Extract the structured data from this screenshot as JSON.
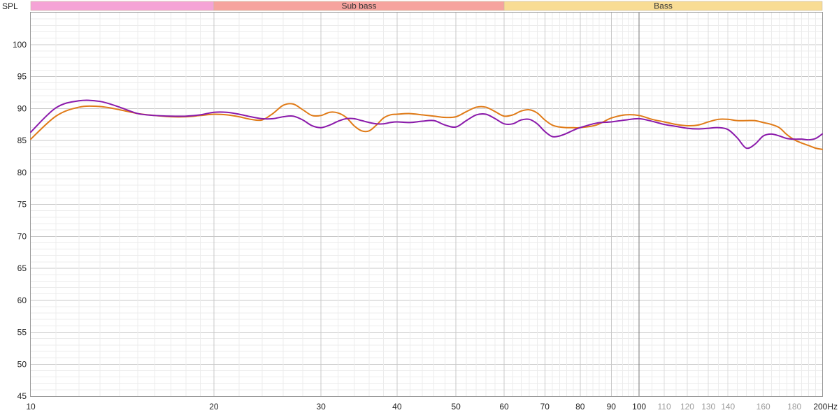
{
  "chart_data": {
    "type": "line",
    "ylabel": "SPL",
    "xunit": "Hz",
    "xscale": "log",
    "xlim": [
      10,
      200
    ],
    "ylim": [
      45,
      105
    ],
    "grid": true,
    "bands": [
      {
        "label": "",
        "from": 10,
        "to": 20,
        "color": "#f5a3d6"
      },
      {
        "label": "Sub bass",
        "from": 20,
        "to": 60,
        "color": "#f6a39e"
      },
      {
        "label": "Bass",
        "from": 60,
        "to": 200,
        "color": "#f8dc94"
      }
    ],
    "y_ticks": [
      {
        "value": 100,
        "label": "100"
      },
      {
        "value": 95,
        "label": "95"
      },
      {
        "value": 90,
        "label": "90"
      },
      {
        "value": 85,
        "label": "85"
      },
      {
        "value": 80,
        "label": "80"
      },
      {
        "value": 75,
        "label": "75"
      },
      {
        "value": 70,
        "label": "70"
      },
      {
        "value": 65,
        "label": "65"
      },
      {
        "value": 60,
        "label": "60"
      },
      {
        "value": 55,
        "label": "55"
      },
      {
        "value": 50,
        "label": "50"
      },
      {
        "value": 45,
        "label": "45"
      }
    ],
    "x_ticks": [
      {
        "value": 10,
        "label": "10",
        "major": true
      },
      {
        "value": 20,
        "label": "20",
        "major": true
      },
      {
        "value": 30,
        "label": "30",
        "major": true
      },
      {
        "value": 40,
        "label": "40",
        "major": true
      },
      {
        "value": 50,
        "label": "50",
        "major": true
      },
      {
        "value": 60,
        "label": "60",
        "major": true
      },
      {
        "value": 70,
        "label": "70",
        "major": true
      },
      {
        "value": 80,
        "label": "80",
        "major": true
      },
      {
        "value": 90,
        "label": "90",
        "major": true
      },
      {
        "value": 100,
        "label": "100",
        "major": true
      },
      {
        "value": 110,
        "label": "110",
        "major": false
      },
      {
        "value": 120,
        "label": "120",
        "major": false
      },
      {
        "value": 130,
        "label": "130",
        "major": false
      },
      {
        "value": 140,
        "label": "140",
        "major": false
      },
      {
        "value": 160,
        "label": "160",
        "major": false
      },
      {
        "value": 180,
        "label": "180",
        "major": false
      },
      {
        "value": 200,
        "label": "200Hz",
        "major": true
      }
    ],
    "series": [
      {
        "color": "#e07b18",
        "x": [
          10,
          11,
          12,
          13,
          14,
          15,
          16,
          17,
          18,
          19,
          20,
          21,
          22,
          23,
          24,
          25,
          26,
          27,
          28,
          29,
          30,
          31,
          32,
          33,
          34,
          35,
          36,
          37,
          38,
          39,
          40,
          42,
          44,
          46,
          48,
          50,
          52,
          54,
          56,
          58,
          60,
          62,
          64,
          66,
          68,
          70,
          72,
          74,
          76,
          78,
          80,
          85,
          90,
          95,
          100,
          105,
          110,
          115,
          120,
          125,
          130,
          135,
          140,
          145,
          150,
          155,
          160,
          165,
          170,
          175,
          180,
          185,
          190,
          195,
          200
        ],
        "y": [
          85.2,
          88.8,
          90.2,
          90.3,
          89.8,
          89.2,
          88.9,
          88.7,
          88.7,
          88.9,
          89.1,
          89.0,
          88.7,
          88.3,
          88.2,
          89.2,
          90.5,
          90.7,
          89.8,
          88.9,
          88.9,
          89.4,
          89.3,
          88.6,
          87.3,
          86.5,
          86.5,
          87.4,
          88.5,
          89.0,
          89.1,
          89.2,
          89.0,
          88.8,
          88.6,
          88.7,
          89.5,
          90.2,
          90.2,
          89.5,
          88.8,
          89.0,
          89.6,
          89.8,
          89.3,
          88.2,
          87.4,
          87.1,
          87.0,
          87.0,
          87.0,
          87.4,
          88.5,
          89.0,
          88.9,
          88.3,
          87.9,
          87.5,
          87.3,
          87.4,
          87.9,
          88.3,
          88.3,
          88.1,
          88.1,
          88.1,
          87.8,
          87.5,
          87.0,
          85.9,
          85.1,
          84.6,
          84.2,
          83.8,
          83.6
        ]
      },
      {
        "color": "#8b1aab",
        "x": [
          10,
          11,
          12,
          13,
          14,
          15,
          16,
          17,
          18,
          19,
          20,
          21,
          22,
          23,
          24,
          25,
          26,
          27,
          28,
          29,
          30,
          31,
          32,
          33,
          34,
          35,
          36,
          37,
          38,
          39,
          40,
          42,
          44,
          46,
          48,
          50,
          52,
          54,
          56,
          58,
          60,
          62,
          64,
          66,
          68,
          70,
          72,
          74,
          76,
          78,
          80,
          85,
          90,
          95,
          100,
          105,
          110,
          115,
          120,
          125,
          130,
          135,
          140,
          145,
          150,
          155,
          160,
          165,
          170,
          175,
          180,
          185,
          190,
          195,
          200
        ],
        "y": [
          86.3,
          90.1,
          91.2,
          91.1,
          90.2,
          89.2,
          88.9,
          88.8,
          88.8,
          89.0,
          89.4,
          89.4,
          89.1,
          88.7,
          88.4,
          88.4,
          88.7,
          88.8,
          88.2,
          87.3,
          87.0,
          87.4,
          88.0,
          88.4,
          88.4,
          88.1,
          87.8,
          87.6,
          87.6,
          87.8,
          87.9,
          87.8,
          88.0,
          88.1,
          87.4,
          87.1,
          88.1,
          89.0,
          89.1,
          88.4,
          87.6,
          87.6,
          88.2,
          88.3,
          87.6,
          86.4,
          85.6,
          85.7,
          86.1,
          86.6,
          87.0,
          87.7,
          87.9,
          88.2,
          88.4,
          88.0,
          87.5,
          87.2,
          86.9,
          86.8,
          86.9,
          87.0,
          86.7,
          85.4,
          83.8,
          84.4,
          85.7,
          86.0,
          85.7,
          85.3,
          85.2,
          85.2,
          85.1,
          85.3,
          86.0
        ]
      }
    ]
  }
}
